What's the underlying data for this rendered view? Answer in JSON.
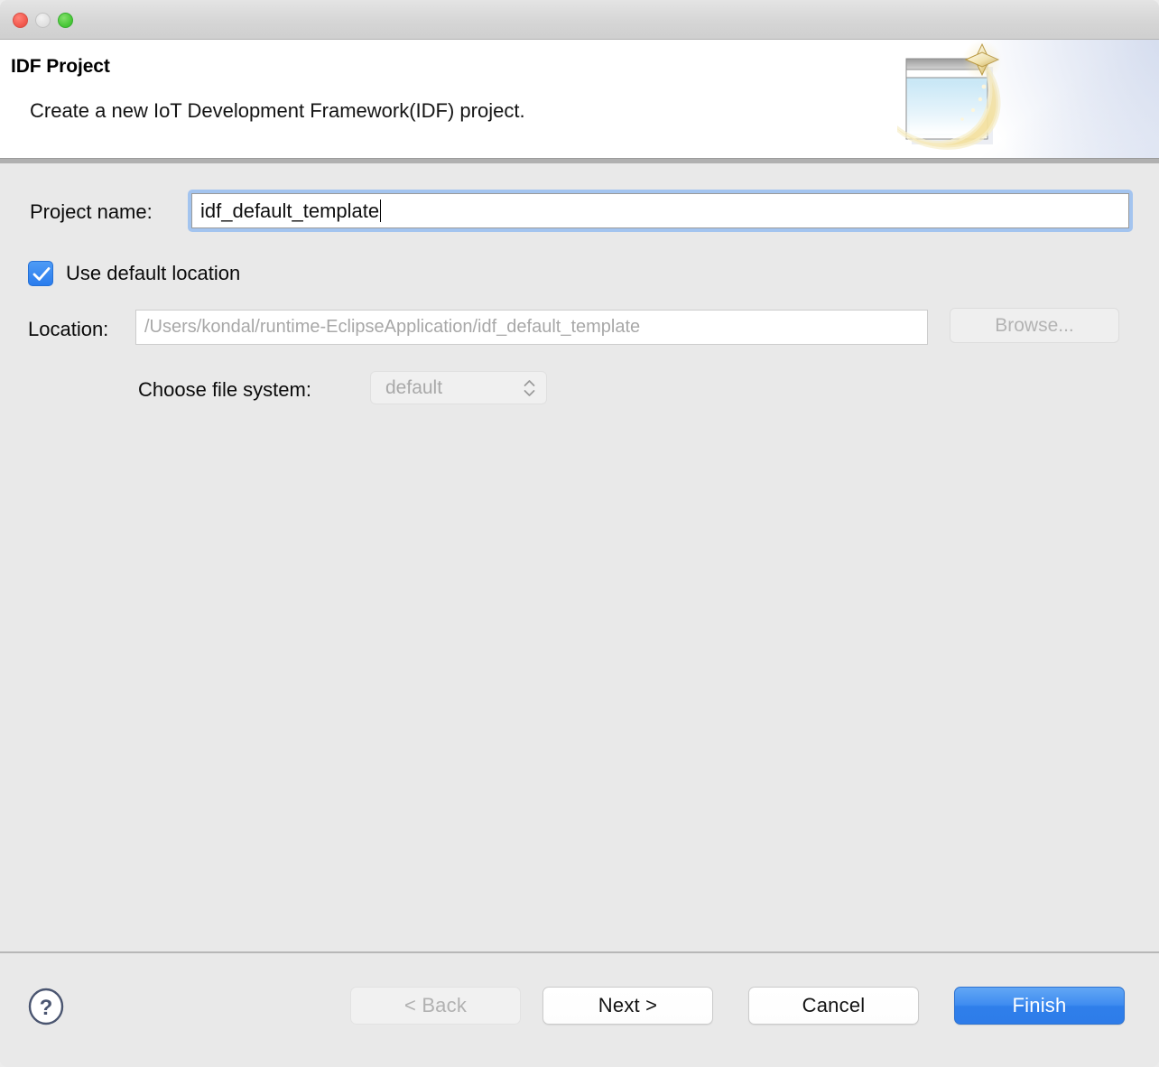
{
  "window": {
    "traffic_lights": [
      "close",
      "minimize",
      "maximize"
    ]
  },
  "header": {
    "title": "IDF Project",
    "description": "Create a new IoT Development Framework(IDF) project.",
    "banner_icon": "new-wizard-window-sparkle-icon"
  },
  "form": {
    "project_name": {
      "label": "Project name:",
      "value": "idf_default_template",
      "placeholder": ""
    },
    "use_default_location": {
      "label": "Use default location",
      "checked": true
    },
    "location": {
      "label": "Location:",
      "value": "",
      "placeholder": "/Users/kondal/runtime-EclipseApplication/idf_default_template",
      "browse_label": "Browse...",
      "browse_enabled": false
    },
    "file_system": {
      "label": "Choose file system:",
      "selected": "default",
      "options": [
        "default"
      ],
      "enabled": false
    }
  },
  "footer": {
    "help_label": "?",
    "buttons": [
      {
        "id": "back",
        "label": "< Back",
        "enabled": false,
        "default": false
      },
      {
        "id": "next",
        "label": "Next >",
        "enabled": true,
        "default": false
      },
      {
        "id": "cancel",
        "label": "Cancel",
        "enabled": true,
        "default": false
      },
      {
        "id": "finish",
        "label": "Finish",
        "enabled": true,
        "default": true
      }
    ]
  },
  "colors": {
    "accent_blue": "#2f7fea",
    "focus_ring": "#a3c4ef",
    "checkbox_blue": "#2a7ced",
    "window_bg": "#e9e9e9",
    "header_bg": "#ffffff",
    "disabled_text": "#b1b1b1",
    "placeholder_text": "#a8a8a8",
    "help_icon": "#4a5570"
  }
}
